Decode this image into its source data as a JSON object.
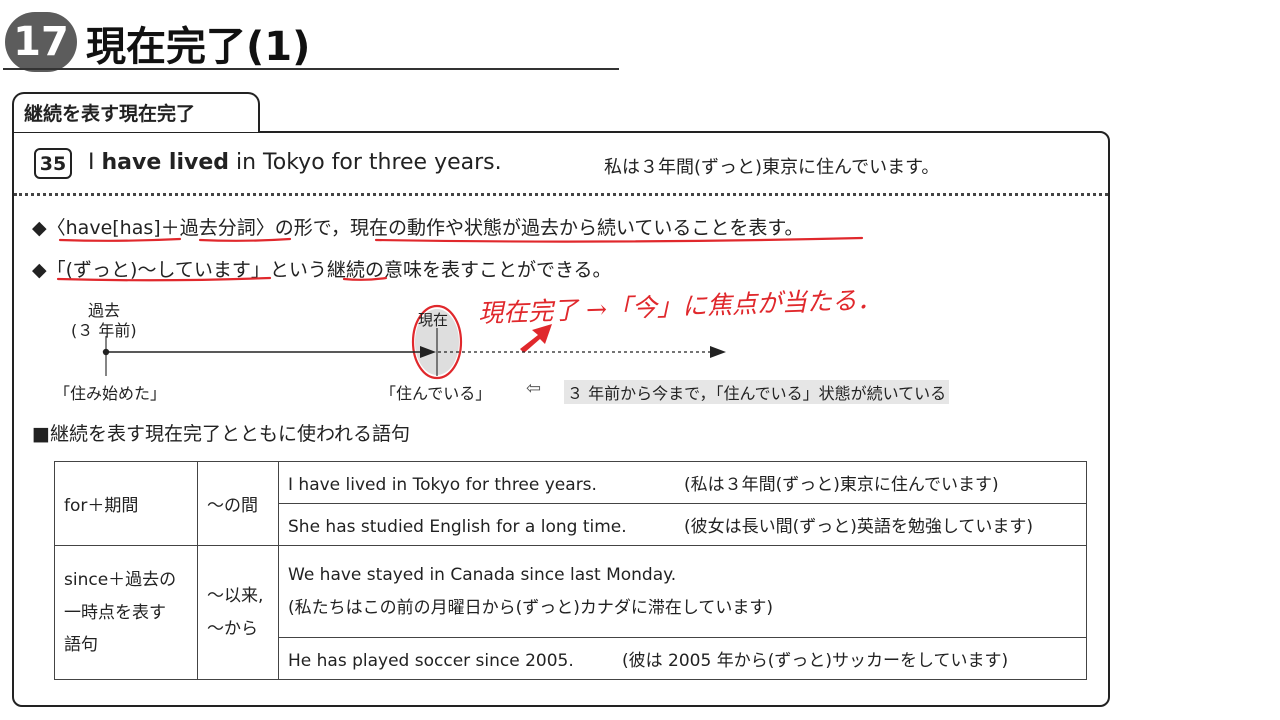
{
  "header": {
    "number": "17",
    "title": "現在完了(1)"
  },
  "section": {
    "tab": "継続を表す現在完了"
  },
  "example": {
    "number": "35",
    "en_before": "I ",
    "en_bold": "have lived",
    "en_after": " in Tokyo for three years.",
    "ja": "私は３年間(ずっと)東京に住んでいます。"
  },
  "explanation": [
    {
      "bullet": "◆",
      "parts": [
        "〈",
        "have[has]",
        "＋",
        "過去分詞",
        "〉の形で，",
        "現在の動作や状態が過去から続いていることを表す",
        "。"
      ]
    },
    {
      "bullet": "◆",
      "parts": [
        "「",
        "(ずっと)～しています",
        "」という",
        "継続",
        "の意味を表すことができる。"
      ]
    }
  ],
  "timeline": {
    "past_label": "過去",
    "past_sub": "(３ 年前)",
    "now_label": "現在",
    "start_label": "「住み始めた」",
    "living_label": "「住んでいる」",
    "note_arrow": "⇦",
    "note": "３ 年前から今まで，「住んでいる」状態が続いている"
  },
  "handwritten": {
    "note": "現在完了 →「今」に焦点が当たる．",
    "color": "#e0282c"
  },
  "vocab": {
    "heading": "■継続を表す現在完了とともに使われる語句",
    "groups": [
      {
        "term": "for＋期間",
        "meaning": "～の間",
        "examples": [
          {
            "en": "I have lived in Tokyo for three years.",
            "ja": "(私は３年間(ずっと)東京に住んでいます)"
          },
          {
            "en": "She has studied English for a long time.",
            "ja": "(彼女は長い間(ずっと)英語を勉強しています)"
          }
        ]
      },
      {
        "term_lines": [
          "since＋過去の",
          "一時点を表す",
          "語句"
        ],
        "meaning_lines": [
          "～以来,",
          "～から"
        ],
        "examples": [
          {
            "en": "We have stayed in Canada since last Monday.",
            "ja": "(私たちはこの前の月曜日から(ずっと)カナダに滞在しています)"
          },
          {
            "en": "He has played soccer since 2005.",
            "ja": "(彼は 2005 年から(ずっと)サッカーをしています)"
          }
        ]
      }
    ]
  }
}
